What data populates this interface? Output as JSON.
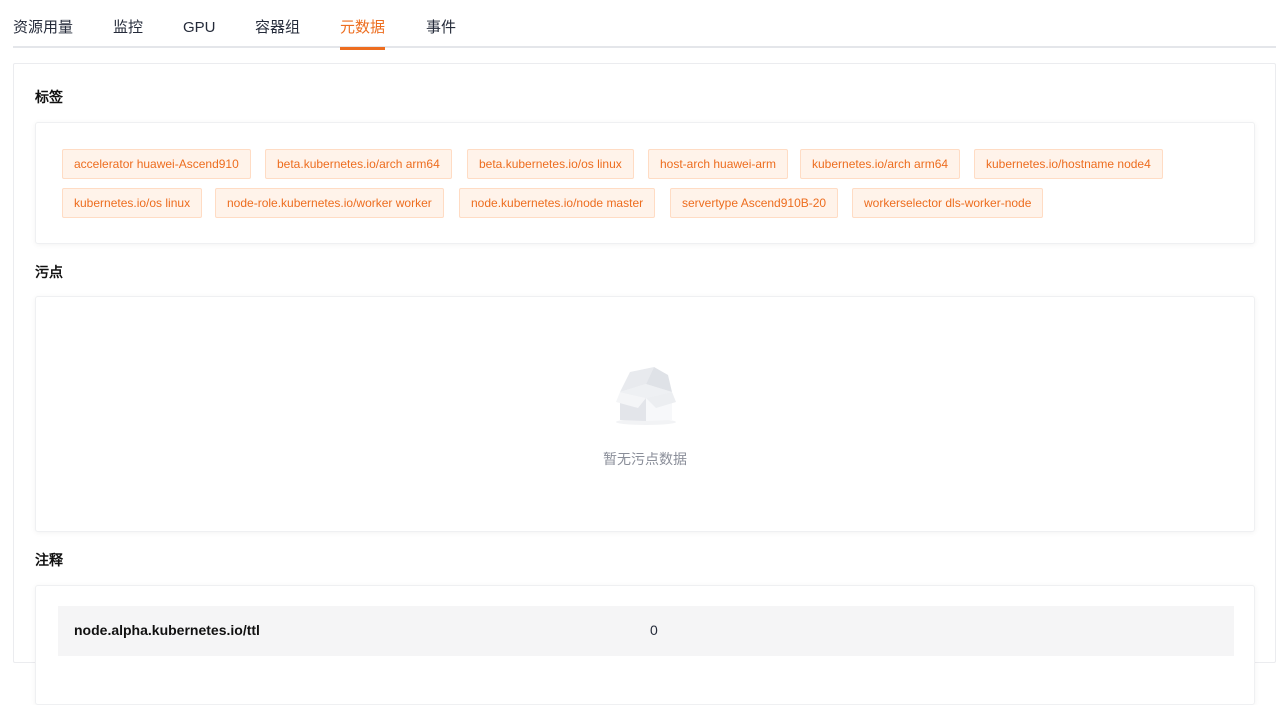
{
  "tabs": [
    {
      "label": "资源用量",
      "active": false
    },
    {
      "label": "监控",
      "active": false
    },
    {
      "label": "GPU",
      "active": false
    },
    {
      "label": "容器组",
      "active": false
    },
    {
      "label": "元数据",
      "active": true
    },
    {
      "label": "事件",
      "active": false
    }
  ],
  "labels_section": {
    "title": "标签",
    "tags": [
      "accelerator huawei-Ascend910",
      "beta.kubernetes.io/arch arm64",
      "beta.kubernetes.io/os linux",
      "host-arch huawei-arm",
      "kubernetes.io/arch arm64",
      "kubernetes.io/hostname node4",
      "kubernetes.io/os linux",
      "node-role.kubernetes.io/worker worker",
      "node.kubernetes.io/node master",
      "servertype Ascend910B-20",
      "workerselector dls-worker-node"
    ]
  },
  "taints_section": {
    "title": "污点",
    "empty_text": "暂无污点数据",
    "empty_icon": "empty-box-icon"
  },
  "annotations_section": {
    "title": "注释",
    "rows": [
      {
        "key": "node.alpha.kubernetes.io/ttl",
        "value": "0"
      }
    ]
  },
  "colors": {
    "accent": "#ed6d1f",
    "tag_bg": "#fff3ea",
    "tag_border": "#ffdcc4",
    "muted_text": "#8a8e99"
  }
}
